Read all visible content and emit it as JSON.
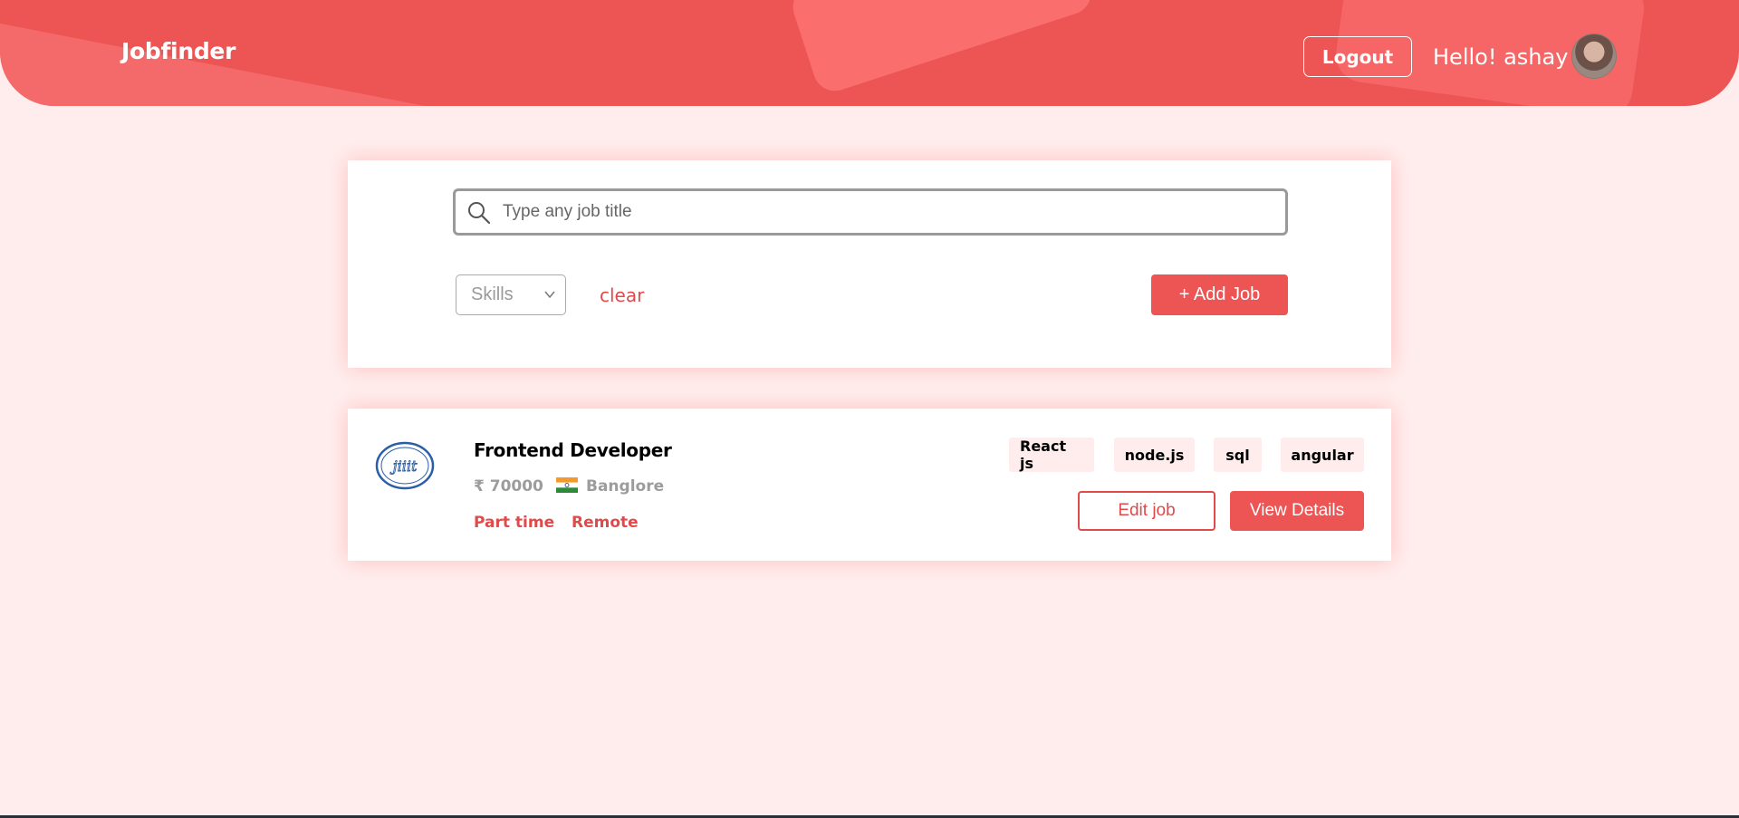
{
  "header": {
    "brand": "Jobfinder",
    "logout_label": "Logout",
    "greeting": "Hello! ashay",
    "colors": {
      "primary": "#ed5454",
      "background": "#ffeded"
    }
  },
  "search": {
    "placeholder": "Type any job title",
    "value": "",
    "skills_select": "Skills",
    "clear_label": "clear",
    "add_job_label": "+ Add Job"
  },
  "jobs": [
    {
      "title": "Frontend Developer",
      "salary": "₹ 70000",
      "location": "Banglore",
      "location_flag": "india-flag-icon",
      "types": [
        "Part time",
        "Remote"
      ],
      "skills": [
        "React js",
        "node.js",
        "sql",
        "angular"
      ],
      "edit_label": "Edit job",
      "view_label": "View Details"
    }
  ]
}
